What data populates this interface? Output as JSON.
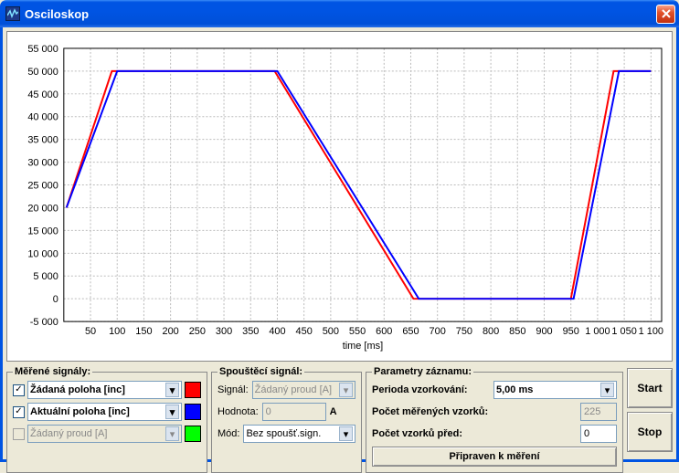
{
  "window": {
    "title": "Osciloskop"
  },
  "chart_data": {
    "type": "line",
    "xlabel": "time [ms]",
    "ylabel": "",
    "xlim": [
      0,
      1120
    ],
    "ylim": [
      -5000,
      55000
    ],
    "xticks": [
      50,
      100,
      150,
      200,
      250,
      300,
      350,
      400,
      450,
      500,
      550,
      600,
      650,
      700,
      750,
      800,
      850,
      900,
      950,
      1000,
      1050,
      1100
    ],
    "yticks": [
      -5000,
      0,
      5000,
      10000,
      15000,
      20000,
      25000,
      30000,
      35000,
      40000,
      45000,
      50000,
      55000
    ],
    "ytick_labels": [
      "-5 000",
      "0",
      "5 000",
      "10 000",
      "15 000",
      "20 000",
      "25 000",
      "30 000",
      "35 000",
      "40 000",
      "45 000",
      "50 000",
      "55 000"
    ],
    "xtick_labels": [
      "50",
      "100",
      "150",
      "200",
      "250",
      "300",
      "350",
      "400",
      "450",
      "500",
      "550",
      "600",
      "650",
      "700",
      "750",
      "800",
      "850",
      "900",
      "950",
      "1 000",
      "1 050",
      "1 100"
    ],
    "series": [
      {
        "name": "Žádaná poloha [inc]",
        "color": "#ff0000",
        "x": [
          5,
          90,
          395,
          655,
          950,
          1030,
          1100
        ],
        "values": [
          20000,
          50000,
          50000,
          0,
          0,
          50000,
          50000
        ]
      },
      {
        "name": "Aktuální poloha [inc]",
        "color": "#0000ff",
        "x": [
          5,
          100,
          400,
          665,
          955,
          1040,
          1100
        ],
        "values": [
          20000,
          50000,
          50000,
          0,
          0,
          50000,
          50000
        ]
      }
    ]
  },
  "signals": {
    "legend": "Měřené signály:",
    "items": [
      {
        "checked": true,
        "enabled": true,
        "label": "Žádaná poloha [inc]",
        "color": "#ff0000"
      },
      {
        "checked": true,
        "enabled": true,
        "label": "Aktuální poloha [inc]",
        "color": "#0000ff"
      },
      {
        "checked": false,
        "enabled": false,
        "label": "Žádaný proud [A]",
        "color": "#00ff00"
      }
    ]
  },
  "trigger": {
    "legend": "Spouštěcí signál:",
    "signal_label": "Signál:",
    "signal_value": "Žádaný proud [A]",
    "hodnota_label": "Hodnota:",
    "hodnota_value": "0",
    "hodnota_unit": "A",
    "mod_label": "Mód:",
    "mod_value": "Bez spoušť.sign."
  },
  "params": {
    "legend": "Parametry záznamu:",
    "period_label": "Perioda vzorkování:",
    "period_value": "5,00 ms",
    "count_label": "Počet měřených vzorků:",
    "count_value": "225",
    "before_label": "Počet vzorků před:",
    "before_value": "0",
    "status": "Připraven k měření"
  },
  "buttons": {
    "start": "Start",
    "stop": "Stop"
  }
}
